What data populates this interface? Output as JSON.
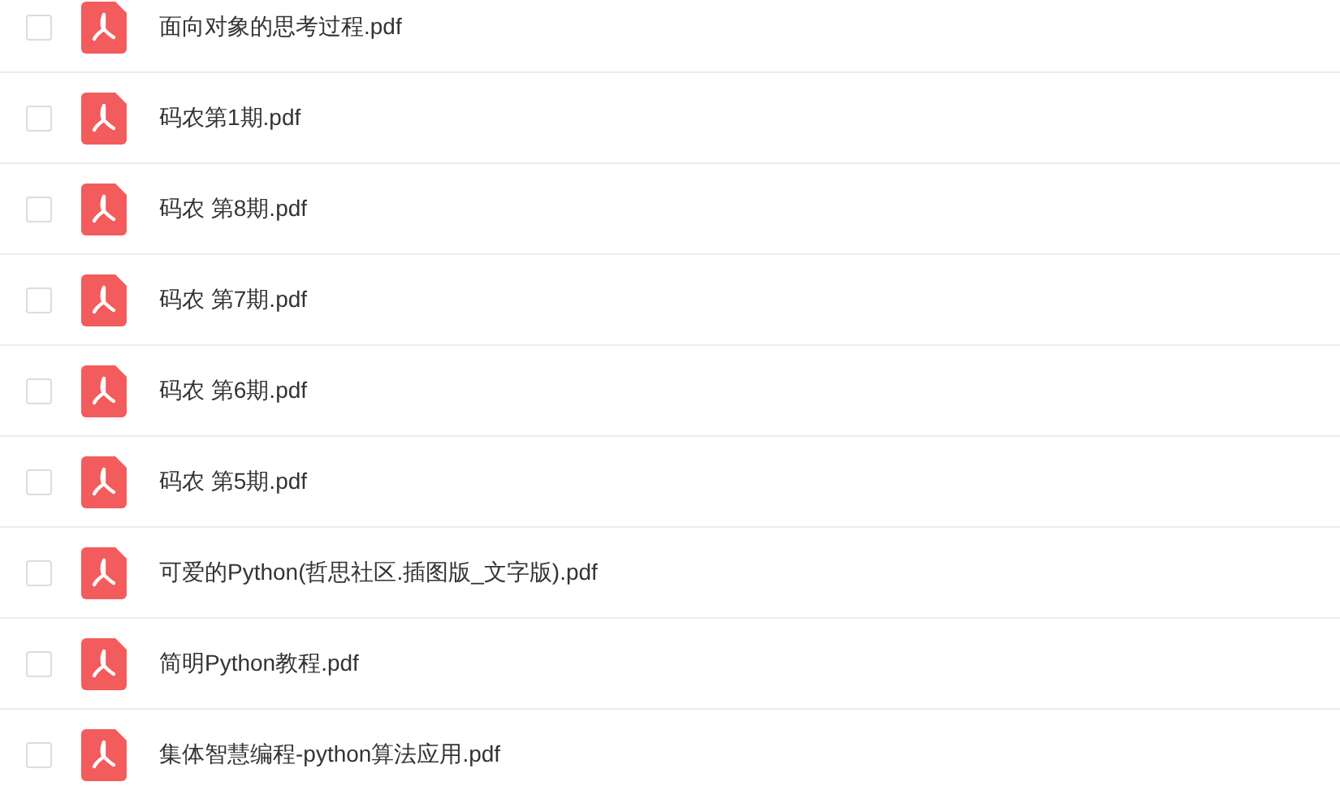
{
  "files": [
    {
      "name": "面向对象的思考过程.pdf",
      "checked": false
    },
    {
      "name": "码农第1期.pdf",
      "checked": false
    },
    {
      "name": "码农 第8期.pdf",
      "checked": false
    },
    {
      "name": "码农 第7期.pdf",
      "checked": false
    },
    {
      "name": "码农 第6期.pdf",
      "checked": false
    },
    {
      "name": "码农 第5期.pdf",
      "checked": false
    },
    {
      "name": "可爱的Python(哲思社区.插图版_文字版).pdf",
      "checked": false
    },
    {
      "name": "简明Python教程.pdf",
      "checked": false
    },
    {
      "name": "集体智慧编程-python算法应用.pdf",
      "checked": false
    }
  ]
}
